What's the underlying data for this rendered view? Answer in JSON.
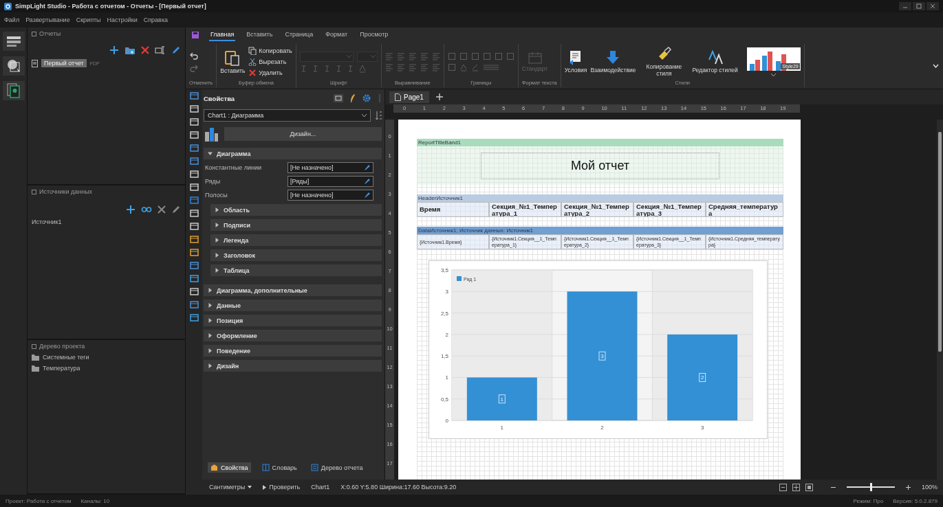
{
  "window": {
    "title": "SimpLight Studio - Работа с отчетом - Отчеты - [Первый отчет]"
  },
  "menu": [
    "Файл",
    "Развертывание",
    "Скрипты",
    "Настройки",
    "Справка"
  ],
  "reports_panel": {
    "title": "Отчеты",
    "items": [
      {
        "label": "Первый отчет",
        "badge": "FDP",
        "selected": true
      }
    ]
  },
  "sources_panel": {
    "title": "Источники данных",
    "items": [
      {
        "label": "Источник1"
      }
    ]
  },
  "project_panel": {
    "title": "Дерево проекта",
    "items": [
      {
        "label": "Системные теги"
      },
      {
        "label": "Температура"
      }
    ]
  },
  "ribbon": {
    "tabs": [
      {
        "label": "Главная",
        "selected": true
      },
      {
        "label": "Вставить",
        "selected": false
      },
      {
        "label": "Страница",
        "selected": false
      },
      {
        "label": "Формат",
        "selected": false
      },
      {
        "label": "Просмотр",
        "selected": false
      }
    ],
    "groups": [
      {
        "kind": "undo",
        "label": "Отменить",
        "disabled": false
      },
      {
        "kind": "clipboard",
        "label": "Буфер обмена",
        "disabled": false,
        "paste": "Вставить",
        "actions": [
          "Копировать",
          "Вырезать",
          "Удалить"
        ]
      },
      {
        "kind": "font",
        "label": "Шрифт",
        "disabled": true
      },
      {
        "kind": "align",
        "label": "Выравнивание",
        "disabled": true
      },
      {
        "kind": "borders",
        "label": "Границы",
        "disabled": true
      },
      {
        "kind": "textformat",
        "label": "Формат текста",
        "disabled": true,
        "button": "Стандарт"
      },
      {
        "kind": "styles",
        "label": "Стили",
        "disabled": false,
        "buttons": [
          "Условия",
          "Взаимодействие",
          "Копирование стиля",
          "Редактор стилей"
        ],
        "gallery": "Style29"
      }
    ]
  },
  "properties": {
    "title": "Свойства",
    "object": "Chart1 : Диаграмма",
    "design_button": "Дизайн...",
    "sections": [
      {
        "label": "Диаграмма",
        "expanded": true,
        "props": [
          {
            "name": "Константные линии",
            "value": "[Не назначено]"
          },
          {
            "name": "Ряды",
            "value": "[Ряды]"
          },
          {
            "name": "Полосы",
            "value": "[Не назначено]"
          }
        ],
        "children": [
          {
            "label": "Область",
            "expanded": false
          },
          {
            "label": "Подписи",
            "expanded": false
          },
          {
            "label": "Легенда",
            "expanded": false
          },
          {
            "label": "Заголовок",
            "expanded": false
          },
          {
            "label": "Таблица",
            "expanded": false
          }
        ]
      },
      {
        "label": "Диаграмма, дополнительные",
        "expanded": false
      },
      {
        "label": "Данные",
        "expanded": false
      },
      {
        "label": "Позиция",
        "expanded": false
      },
      {
        "label": "Оформление",
        "expanded": false
      },
      {
        "label": "Поведение",
        "expanded": false
      },
      {
        "label": "Дизайн",
        "expanded": false
      }
    ],
    "bottom_tabs": [
      {
        "label": "Свойства",
        "selected": true
      },
      {
        "label": "Словарь",
        "selected": false
      },
      {
        "label": "Дерево отчета",
        "selected": false
      }
    ]
  },
  "designer": {
    "tabs": [
      {
        "label": "Page1",
        "selected": true
      }
    ],
    "ruler_h": [
      "0",
      "1",
      "2",
      "3",
      "4",
      "5",
      "6",
      "7",
      "8",
      "9",
      "10",
      "11",
      "12",
      "13",
      "14",
      "15",
      "16",
      "17",
      "18",
      "19"
    ],
    "ruler_v": [
      "0",
      "1",
      "2",
      "3",
      "4",
      "5",
      "6",
      "7",
      "8",
      "9",
      "10",
      "11",
      "12",
      "13",
      "14",
      "15",
      "16",
      "17"
    ],
    "bands": [
      {
        "kind": "title",
        "label": "ReportTitleBand1",
        "color": "#a8dcbc",
        "text": "Мой отчет"
      },
      {
        "kind": "header",
        "label": "HeaderИсточник1",
        "color": "#b9cce2",
        "cells": [
          "Время",
          "Секция_№1_Температура_1",
          "Секция_№1_Температура_2",
          "Секция_№1_Температура_3",
          "Средняя_температура"
        ]
      },
      {
        "kind": "data",
        "label": "DataИсточник1; Источник данных: Источник1",
        "color": "#6f9fd3",
        "cells": [
          "{Источник1.Время}",
          "{Источник1.Секция__1_Температура_1}",
          "{Источник1.Секция__1_Температура_2}",
          "{Источник1.Секция__1_Температура_3}",
          "{Источник1.Средняя_температура}"
        ]
      }
    ],
    "chart": {
      "chart_data": {
        "type": "bar",
        "categories": [
          "1",
          "2",
          "3"
        ],
        "series": [
          {
            "name": "Ряд 1",
            "color": "#3390d4",
            "values": [
              1,
              3,
              2
            ]
          }
        ],
        "ylim": [
          0,
          3.5
        ],
        "yticks": [
          {
            "value": 0,
            "label": "0"
          },
          {
            "value": 0.5,
            "label": "0,5"
          },
          {
            "value": 1,
            "label": "1"
          },
          {
            "value": 1.5,
            "label": "1,5"
          },
          {
            "value": 2,
            "label": "2"
          },
          {
            "value": 2.5,
            "label": "2,5"
          },
          {
            "value": 3,
            "label": "3"
          },
          {
            "value": 3.5,
            "label": "3,5"
          }
        ],
        "data_labels": true,
        "grid": true
      }
    }
  },
  "designer_status": {
    "units": "Сантиметры",
    "check": "Проверить",
    "object": "Chart1",
    "geometry": "X:0.60 Y:5.80 Ширина:17.60 Высота:9.20",
    "zoom": {
      "level": 0.5,
      "reading": "100%"
    }
  },
  "status_bar": {
    "project": "Проект: Работа с отчетом",
    "channels": "Каналы: 10",
    "mode": "Режим: Про",
    "version": "Версия: 5.0.2.879"
  }
}
